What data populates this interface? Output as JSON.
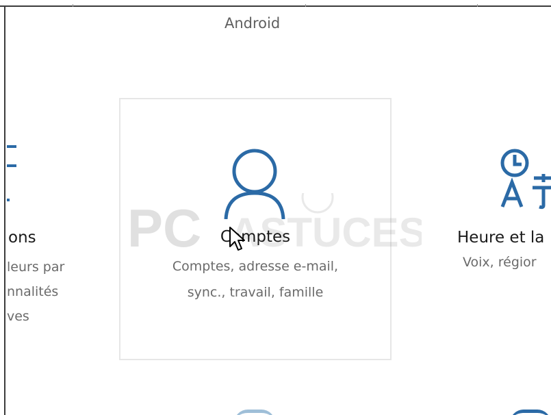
{
  "previous_row": {
    "android_label": "Android"
  },
  "tiles": {
    "left": {
      "title": "ons",
      "desc_lines": [
        "leurs par",
        "nnalités",
        "ves"
      ]
    },
    "main": {
      "title": "Comptes",
      "desc_line1": "Comptes, adresse e-mail,",
      "desc_line2": "sync., travail, famille"
    },
    "right": {
      "title": "Heure et la",
      "desc": "Voix, régior"
    }
  },
  "watermark": {
    "text_pc": "PC",
    "text_astuces": "ASTUCES"
  },
  "icons": {
    "left_tile": "apps-icon",
    "main_tile": "person-icon",
    "right_tile": "time-language-icon",
    "cursor": "mouse-pointer-icon"
  },
  "colors": {
    "accent": "#2b6aa6",
    "tile_border": "#e6e6e6",
    "desc_text": "#6a6a6a"
  }
}
